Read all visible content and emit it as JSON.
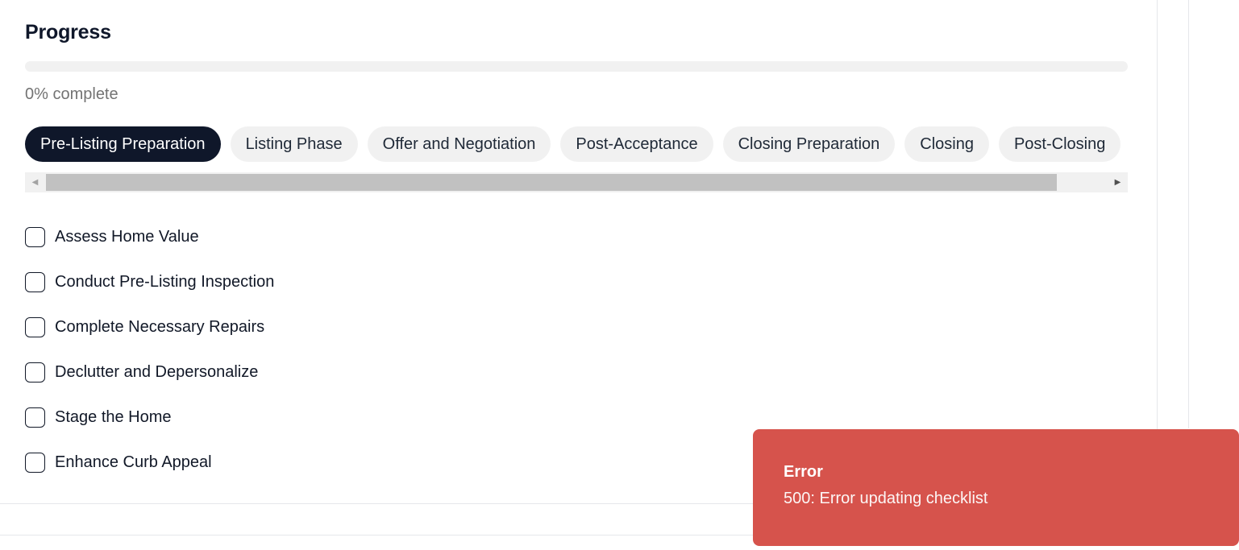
{
  "progress": {
    "title": "Progress",
    "percent": 0,
    "label": "0% complete"
  },
  "phases": [
    {
      "label": "Pre-Listing Preparation",
      "active": true
    },
    {
      "label": "Listing Phase",
      "active": false
    },
    {
      "label": "Offer and Negotiation",
      "active": false
    },
    {
      "label": "Post-Acceptance",
      "active": false
    },
    {
      "label": "Closing Preparation",
      "active": false
    },
    {
      "label": "Closing",
      "active": false
    },
    {
      "label": "Post-Closing",
      "active": false
    }
  ],
  "checklist": [
    {
      "label": "Assess Home Value",
      "checked": false
    },
    {
      "label": "Conduct Pre-Listing Inspection",
      "checked": false
    },
    {
      "label": "Complete Necessary Repairs",
      "checked": false
    },
    {
      "label": "Declutter and Depersonalize",
      "checked": false
    },
    {
      "label": "Stage the Home",
      "checked": false
    },
    {
      "label": "Enhance Curb Appeal",
      "checked": false
    }
  ],
  "toast": {
    "title": "Error",
    "message": "500: Error updating checklist"
  },
  "icons": {
    "scroll_left": "caret-left-icon",
    "scroll_right": "caret-right-icon"
  },
  "colors": {
    "active_tab": "#0f172a",
    "toast_background": "#d6534c"
  }
}
